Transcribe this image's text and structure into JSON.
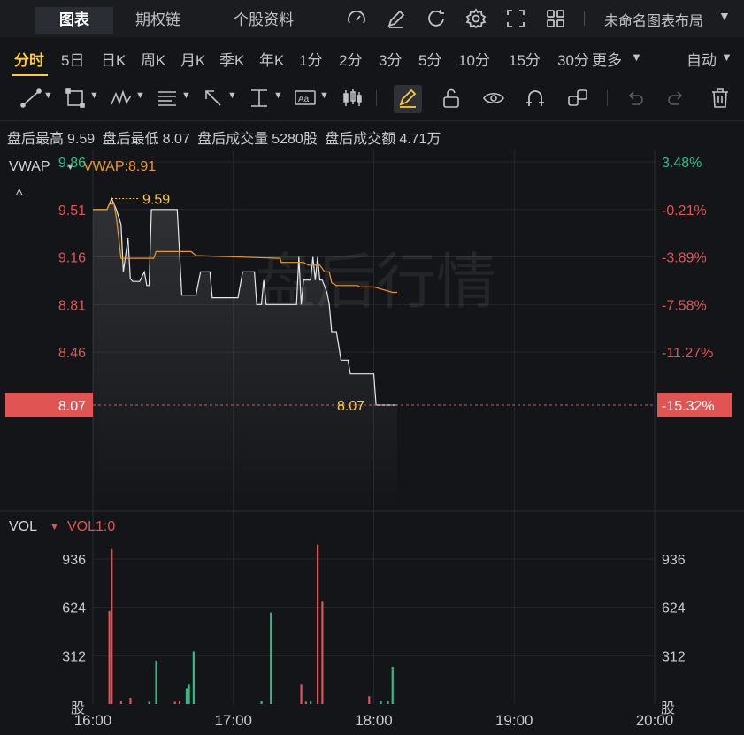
{
  "tabs": [
    {
      "label": "图表",
      "active": true
    },
    {
      "label": "期权链",
      "active": false
    },
    {
      "label": "个股资料",
      "active": false
    }
  ],
  "toolbar_icons": [
    "gauge-icon",
    "pen-edit-icon",
    "refresh-icon",
    "gear-icon",
    "fullscreen-icon",
    "grid-icon"
  ],
  "layout_name": "未命名图表布局",
  "periods": [
    {
      "label": "分时",
      "active": true
    },
    {
      "label": "5日"
    },
    {
      "label": "日K"
    },
    {
      "label": "周K"
    },
    {
      "label": "月K"
    },
    {
      "label": "季K"
    },
    {
      "label": "年K"
    },
    {
      "label": "1分"
    },
    {
      "label": "2分"
    },
    {
      "label": "3分"
    },
    {
      "label": "5分"
    },
    {
      "label": "10分"
    },
    {
      "label": "15分"
    },
    {
      "label": "30分"
    },
    {
      "label": "更多"
    }
  ],
  "auto_label": "自动",
  "info": {
    "high_label": "盘后最高",
    "high": "9.59",
    "low_label": "盘后最低",
    "low": "8.07",
    "vol_label": "盘后成交量",
    "vol": "5280股",
    "amt_label": "盘后成交额",
    "amt": "4.71万"
  },
  "indicator": {
    "name": "VWAP",
    "value_label": "VWAP:8.91"
  },
  "watermark": "盘后行情",
  "colors": {
    "up": "#e05454",
    "down": "#2ebd85",
    "vwap": "#e89a2c",
    "price": "#e6e8eb",
    "accent": "#ffcc33"
  },
  "chart_data": {
    "type": "line",
    "x_ticks": [
      "16:00",
      "17:00",
      "18:00",
      "19:00",
      "20:00"
    ],
    "price_ticks": [
      "9.86",
      "9.51",
      "9.16",
      "8.81",
      "8.46"
    ],
    "pct_ticks": [
      "3.48%",
      "-0.21%",
      "-3.89%",
      "-7.58%",
      "-11.27%"
    ],
    "current_price": "8.07",
    "current_pct": "-15.32%",
    "high_marker": "9.59",
    "low_marker": "8.07",
    "ylim": [
      8.07,
      9.86
    ],
    "price_series": [
      [
        0,
        9.51
      ],
      [
        6,
        9.51
      ],
      [
        8,
        9.59
      ],
      [
        10,
        9.51
      ],
      [
        12,
        9.4
      ],
      [
        13,
        9.05
      ],
      [
        15,
        9.3
      ],
      [
        16,
        9.0
      ],
      [
        17,
        8.98
      ],
      [
        20,
        8.98
      ],
      [
        22,
        9.05
      ],
      [
        23,
        8.95
      ],
      [
        24,
        8.95
      ],
      [
        25,
        9.51
      ],
      [
        36,
        9.51
      ],
      [
        38,
        8.88
      ],
      [
        44,
        8.88
      ],
      [
        46,
        9.05
      ],
      [
        50,
        9.05
      ],
      [
        51,
        8.86
      ],
      [
        62,
        8.86
      ],
      [
        64,
        9.05
      ],
      [
        69,
        9.05
      ],
      [
        70,
        8.81
      ],
      [
        72,
        8.81
      ],
      [
        73,
        8.99
      ],
      [
        74,
        8.81
      ],
      [
        87,
        8.81
      ],
      [
        88,
        9.16
      ],
      [
        89,
        8.81
      ],
      [
        90,
        8.99
      ],
      [
        93,
        8.99
      ],
      [
        94,
        9.16
      ],
      [
        95,
        8.99
      ],
      [
        96,
        9.16
      ],
      [
        97,
        8.99
      ],
      [
        98,
        8.99
      ],
      [
        100,
        8.9
      ],
      [
        101,
        8.81
      ],
      [
        102,
        8.61
      ],
      [
        104,
        8.61
      ],
      [
        105,
        8.51
      ],
      [
        106,
        8.4
      ],
      [
        109,
        8.4
      ],
      [
        110,
        8.3
      ],
      [
        120,
        8.3
      ],
      [
        121,
        8.07
      ],
      [
        130,
        8.07
      ]
    ],
    "vwap_series": [
      [
        0,
        9.51
      ],
      [
        6,
        9.51
      ],
      [
        7,
        9.55
      ],
      [
        9,
        9.55
      ],
      [
        10,
        9.45
      ],
      [
        12,
        9.15
      ],
      [
        26,
        9.15
      ],
      [
        27,
        9.2
      ],
      [
        42,
        9.2
      ],
      [
        44,
        9.17
      ],
      [
        80,
        9.15
      ],
      [
        80.5,
        9.12
      ],
      [
        90,
        9.12
      ],
      [
        92,
        9.1
      ],
      [
        97,
        9.1
      ],
      [
        99,
        9.05
      ],
      [
        101,
        9.05
      ],
      [
        102,
        8.97
      ],
      [
        104,
        8.95
      ],
      [
        113,
        8.95
      ],
      [
        114,
        8.94
      ],
      [
        120,
        8.94
      ],
      [
        122,
        8.93
      ],
      [
        124,
        8.92
      ],
      [
        126,
        8.91
      ],
      [
        128,
        8.9
      ],
      [
        130,
        8.9
      ]
    ],
    "volume_ticks": [
      "936",
      "624",
      "312"
    ],
    "volume_unit": "股",
    "volume_indicator": {
      "name": "VOL",
      "value_label": "VOL1:0"
    },
    "volume_bars": [
      [
        7,
        600,
        "up"
      ],
      [
        8,
        1000,
        "up"
      ],
      [
        12,
        20,
        "up"
      ],
      [
        16,
        40,
        "up"
      ],
      [
        24,
        15,
        "down"
      ],
      [
        27,
        280,
        "down"
      ],
      [
        35,
        15,
        "up"
      ],
      [
        37,
        20,
        "up"
      ],
      [
        40,
        100,
        "down"
      ],
      [
        41,
        130,
        "down"
      ],
      [
        43,
        340,
        "down"
      ],
      [
        72,
        20,
        "down"
      ],
      [
        76,
        590,
        "down"
      ],
      [
        89,
        130,
        "up"
      ],
      [
        91,
        15,
        "up"
      ],
      [
        93,
        20,
        "down"
      ],
      [
        96,
        1030,
        "up"
      ],
      [
        98,
        660,
        "up"
      ],
      [
        118,
        50,
        "up"
      ],
      [
        123,
        20,
        "down"
      ],
      [
        126,
        20,
        "down"
      ],
      [
        128,
        240,
        "down"
      ]
    ]
  }
}
